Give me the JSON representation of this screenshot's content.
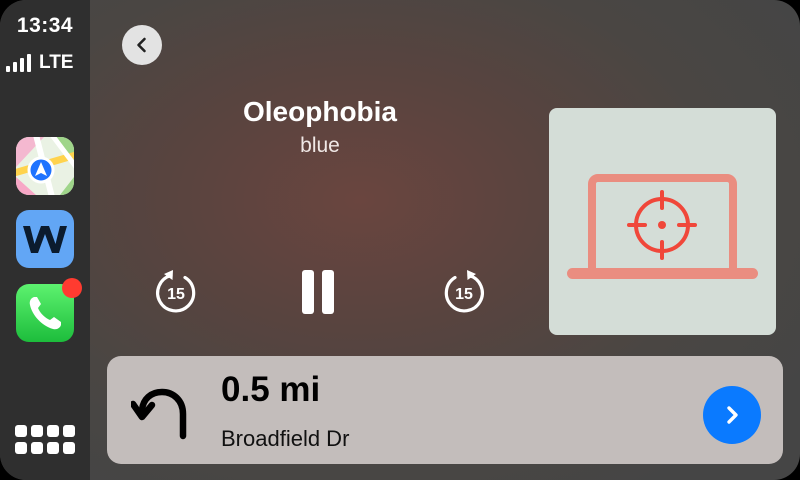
{
  "status": {
    "time": "13:34",
    "network": "LTE"
  },
  "sidebar": {
    "apps": [
      {
        "name": "Maps",
        "icon": "maps-icon"
      },
      {
        "name": "Waze",
        "icon": "w-app-icon"
      },
      {
        "name": "Phone",
        "icon": "phone-icon",
        "badge": true
      }
    ],
    "grid_icon": "app-grid-icon"
  },
  "player": {
    "title": "Oleophobia",
    "artist": "blue",
    "skip_back_seconds": "15",
    "skip_forward_seconds": "15",
    "state": "playing"
  },
  "navigation": {
    "distance": "0.5 mi",
    "street": "Broadfield Dr",
    "maneuver_icon": "u-turn-left-icon"
  },
  "colors": {
    "accent_blue": "#0a7aff",
    "badge_red": "#ff3b30",
    "artwork_bg": "#d4ddd7",
    "artwork_line": "#ea8d80",
    "artwork_target": "#f0473a"
  }
}
